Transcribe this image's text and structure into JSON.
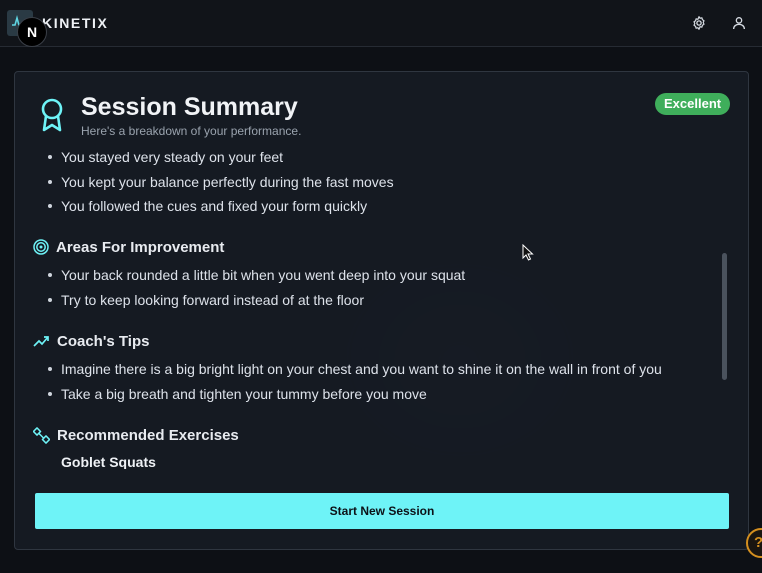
{
  "app": {
    "brand": "KINETIX",
    "next_badge": "N"
  },
  "header_icons": [
    "settings-gear-icon",
    "user-icon"
  ],
  "card": {
    "title": "Session Summary",
    "subtitle": "Here's a breakdown of your performance.",
    "rating_badge": "Excellent",
    "strengths_partial": [
      "You stayed very steady on your feet",
      "You kept your balance perfectly during the fast moves",
      "You followed the cues and fixed your form quickly"
    ],
    "improvement": {
      "heading": "Areas For Improvement",
      "items": [
        "Your back rounded a little bit when you went deep into your squat",
        "Try to keep looking forward instead of at the floor"
      ]
    },
    "tips": {
      "heading": "Coach's Tips",
      "items": [
        "Imagine there is a big bright light on your chest and you want to shine it on the wall in front of you",
        "Take a big breath and tighten your tummy before you move"
      ]
    },
    "exercises": {
      "heading": "Recommended Exercises",
      "items": [
        "Goblet Squats"
      ]
    },
    "start_button": "Start New Session"
  },
  "help_button": "?",
  "colors": {
    "accent": "#6ef3f7",
    "badge_green": "#3fae5b",
    "help_orange": "#d48f1f"
  }
}
